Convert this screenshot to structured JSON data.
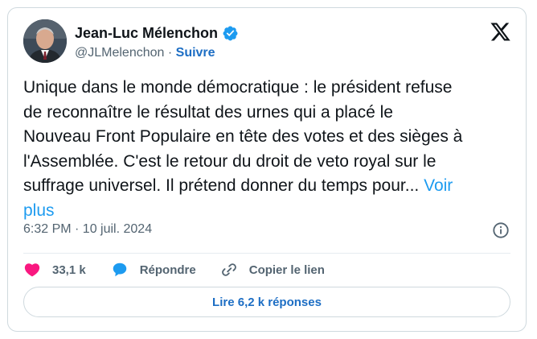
{
  "author": {
    "name": "Jean-Luc Mélenchon",
    "handle": "@JLMelenchon",
    "separator": " · ",
    "follow_label": "Suivre"
  },
  "tweet": {
    "text": "Unique dans le monde démocratique : le président refuse\nde reconnaître le résultat des urnes qui a placé le\nNouveau Front Populaire en tête des votes et des sièges à\nl'Assemblée. C'est le retour du droit de veto royal sur le\nsuffrage universel. Il prétend donner du temps pour... ",
    "show_more_label": "Voir\nplus",
    "timestamp": "6:32 PM · 10 juil. 2024"
  },
  "actions": {
    "likes": "33,1 k",
    "reply_label": "Répondre",
    "copy_link_label": "Copier le lien"
  },
  "replies_button_label": "Lire 6,2 k réponses",
  "icons": {
    "platform": "x-logo-icon",
    "verified": "verified-badge-icon",
    "info": "info-icon",
    "like": "heart-icon",
    "reply": "speech-bubble-icon",
    "copy": "link-icon"
  },
  "colors": {
    "accent_blue": "#1d9bf0",
    "link_blue": "#1d6ec4",
    "like_red": "#f91880",
    "muted_text": "#536471"
  }
}
